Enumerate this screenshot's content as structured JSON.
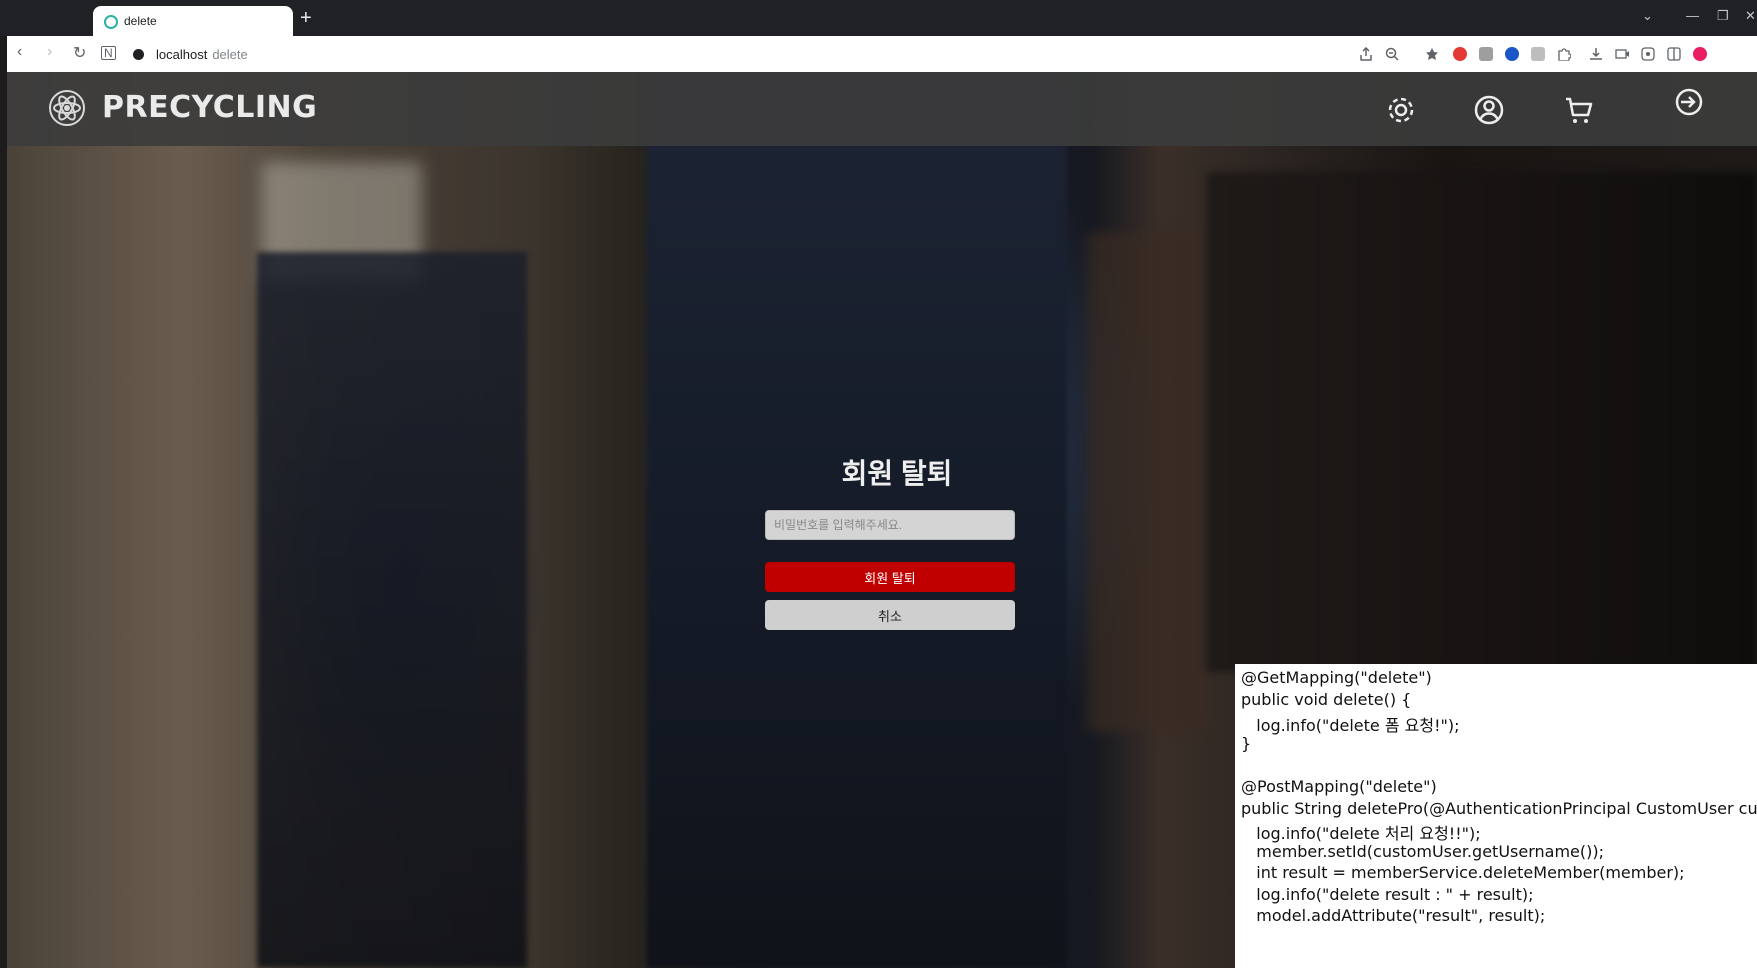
{
  "browser": {
    "tab_title": "delete",
    "new_tab": "+",
    "url_host": "localhost",
    "url_path": "delete",
    "window_controls": [
      "⌄",
      "—",
      "❐",
      "✕"
    ]
  },
  "header": {
    "brand": "PRECYCLING",
    "icons": [
      "gear-icon",
      "user-icon",
      "cart-icon",
      "login-icon"
    ]
  },
  "form": {
    "title": "회원 탈퇴",
    "password_placeholder": "비밀번호를 입력해주세요.",
    "delete_label": "회원 탈퇴",
    "cancel_label": "취소"
  },
  "code_lines": [
    "@GetMapping(\"delete\")",
    "public void delete() {",
    "   log.info(\"delete 폼 요청!\");",
    "}",
    "",
    "@PostMapping(\"delete\")",
    "public String deletePro(@AuthenticationPrincipal CustomUser customU",
    "   log.info(\"delete 처리 요청!!\");",
    "   member.setId(customUser.getUsername());",
    "   int result = memberService.deleteMember(member);",
    "   log.info(\"delete result : \" + result);",
    "   model.addAttribute(\"result\", result);"
  ],
  "colors": {
    "accent_red": "#c00000",
    "header_bg": "#3c3c3c"
  }
}
